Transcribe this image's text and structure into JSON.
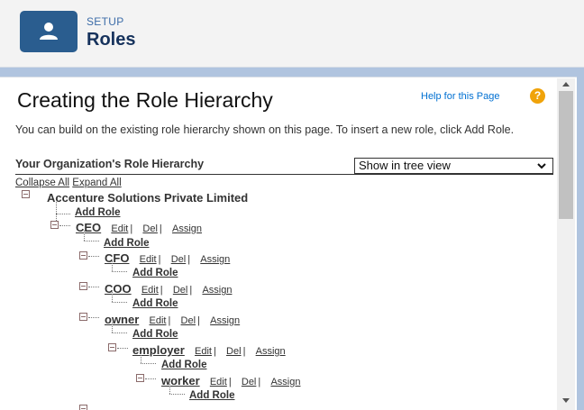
{
  "header": {
    "breadcrumb": "SETUP",
    "title": "Roles",
    "icon": "user-icon"
  },
  "main": {
    "heading": "Creating the Role Hierarchy",
    "help_link": "Help for this Page",
    "help_icon": "?",
    "intro_text": "You can build on the existing role hierarchy shown on this page. To insert a new role, click Add Role.",
    "section_title": "Your Organization's Role Hierarchy",
    "view_select_value": "Show in tree view",
    "collapse_all": "Collapse All",
    "expand_all": "Expand All"
  },
  "tree": {
    "root": "Accenture Solutions Private Limited",
    "add_role": "Add Role",
    "edit": "Edit",
    "del": "Del",
    "assign": "Assign",
    "separator": "|",
    "roles": {
      "ceo": "CEO",
      "cfo": "CFO",
      "coo": "COO",
      "owner": "owner",
      "employer": "employer",
      "worker": "worker"
    }
  },
  "colors": {
    "header_bg": "#f3f3f3",
    "icon_bg": "#2a5d8f",
    "link_blue": "#0070d2",
    "help_orange": "#f0a30a",
    "page_bg": "#b0c4df"
  }
}
